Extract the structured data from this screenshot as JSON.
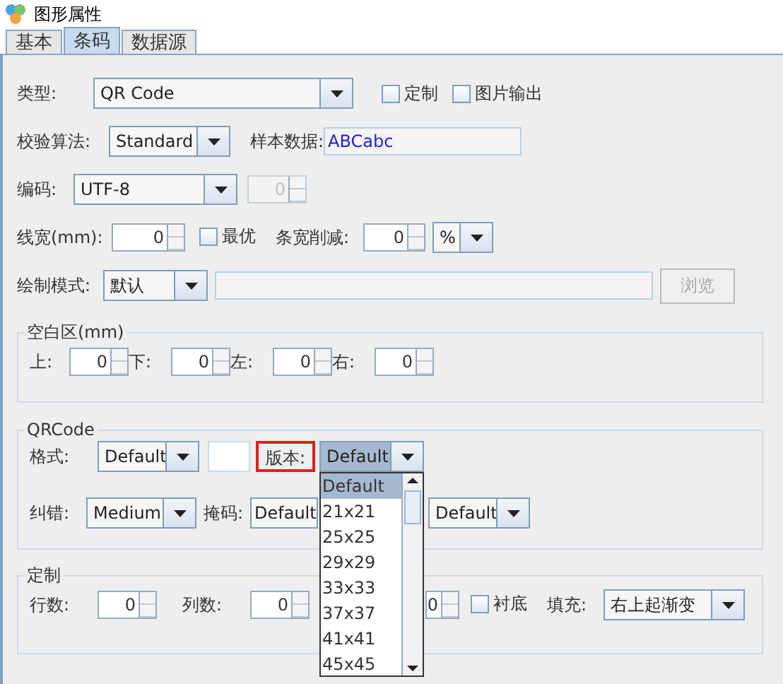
{
  "window": {
    "title": "图形属性"
  },
  "tabs": [
    {
      "label": "基本",
      "selected": false
    },
    {
      "label": "条码",
      "selected": true
    },
    {
      "label": "数据源",
      "selected": false
    }
  ],
  "type": {
    "label": "类型:",
    "value": "QR Code"
  },
  "options": [
    {
      "label": "定制",
      "checked": false
    },
    {
      "label": "图片输出",
      "checked": false
    }
  ],
  "check_algorithm": {
    "label": "校验算法:",
    "value": "Standard"
  },
  "sample_data": {
    "label": "样本数据:",
    "value": "ABCabc"
  },
  "encoding": {
    "label": "编码:",
    "value": "UTF-8",
    "spinner": {
      "value": "0",
      "disabled": true
    }
  },
  "line_width": {
    "label": "线宽(mm):",
    "value": "0"
  },
  "optimal": {
    "label": "最优",
    "checked": false
  },
  "bar_reduction": {
    "label": "条宽削减:",
    "value": "0",
    "unit": "%"
  },
  "draw_mode": {
    "label": "绘制模式:",
    "value": "默认",
    "browse": {
      "label": "浏览",
      "disabled": true
    }
  },
  "quiet_zone": {
    "title": "空白区(mm)",
    "fields": [
      {
        "label": "上:",
        "value": "0"
      },
      {
        "label": "下:",
        "value": "0"
      },
      {
        "label": "左:",
        "value": "0"
      },
      {
        "label": "右:",
        "value": "0"
      }
    ]
  },
  "qrcode": {
    "title": "QRCode",
    "format": {
      "label": "格式:",
      "value": "Default"
    },
    "version": {
      "label": "版本:",
      "value": "Default",
      "highlighted": true,
      "open": true,
      "options": [
        {
          "label": "Default",
          "selected": true
        },
        {
          "label": "21x21",
          "selected": false
        },
        {
          "label": "25x25",
          "selected": false
        },
        {
          "label": "29x29",
          "selected": false
        },
        {
          "label": "33x33",
          "selected": false
        },
        {
          "label": "37x37",
          "selected": false
        },
        {
          "label": "41x41",
          "selected": false
        },
        {
          "label": "45x45",
          "selected": false
        }
      ]
    },
    "error_correction": {
      "label": "纠错:",
      "value": "Medium"
    },
    "mask": {
      "label": "掩码:",
      "value": "Default"
    },
    "combo_4": {
      "value": "Default"
    }
  },
  "custom": {
    "title": "定制",
    "rows": {
      "label": "行数:",
      "value": "0"
    },
    "columns": {
      "label": "列数:",
      "value": "0"
    },
    "spinner_3": {
      "value": "0"
    },
    "backing": {
      "label": "衬底",
      "checked": false
    },
    "fill": {
      "label": "填充:",
      "value": "右上起渐变"
    }
  }
}
